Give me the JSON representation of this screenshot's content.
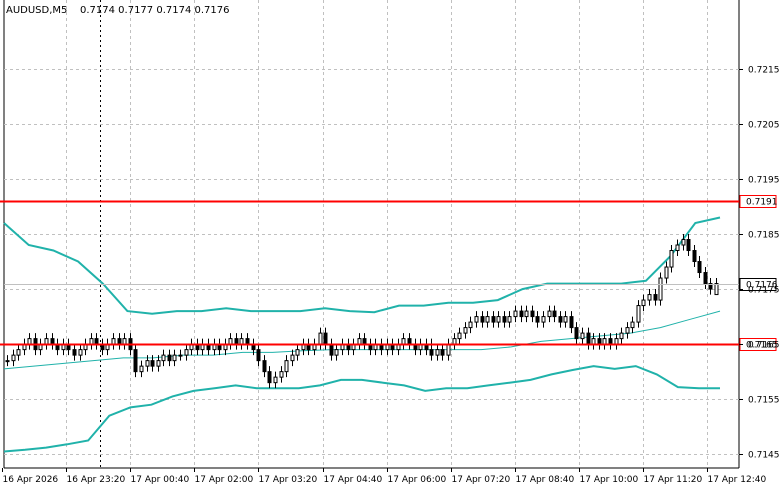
{
  "header": {
    "symbol_label": "AUDUSD,M5",
    "ohlc_label": "0.7174 0.7177 0.7174 0.7176"
  },
  "chart_data": {
    "type": "candlestick",
    "symbol": "AUDUSD",
    "timeframe": "M5",
    "ylim": [
      0.71425,
      0.72275
    ],
    "y_ticks": [
      "0.7215",
      "0.7205",
      "0.7195",
      "0.7185",
      "0.7175",
      "0.7165",
      "0.7155",
      "0.7145"
    ],
    "x_ticks": [
      "16 Apr 2026",
      "16 Apr 23:20",
      "17 Apr 00:40",
      "17 Apr 02:00",
      "17 Apr 03:20",
      "17 Apr 04:40",
      "17 Apr 06:00",
      "17 Apr 07:20",
      "17 Apr 08:40",
      "17 Apr 10:00",
      "17 Apr 11:20",
      "17 Apr 12:40"
    ],
    "grid": true,
    "horizontal_lines": [
      {
        "value": 0.7191,
        "label": "0.7191",
        "color": "#ff0000"
      },
      {
        "value": 0.7165,
        "label": "0.7165",
        "color": "#ff0000"
      }
    ],
    "current_price": {
      "value": 0.7176,
      "label": "0.7176"
    },
    "period_separator_x": "16 Apr 23:20",
    "bollinger": {
      "color": "#20b2aa",
      "upper": [
        0.7187,
        0.7183,
        0.7182,
        0.718,
        0.7176,
        0.7171,
        0.71705,
        0.7171,
        0.7171,
        0.71715,
        0.7171,
        0.7171,
        0.7171,
        0.71715,
        0.7171,
        0.71708,
        0.7172,
        0.7172,
        0.71725,
        0.71725,
        0.7173,
        0.7175,
        0.7176,
        0.7176,
        0.7176,
        0.7176,
        0.71765,
        0.7181,
        0.7187,
        0.7188
      ],
      "middle": [
        0.71605,
        0.7161,
        0.71615,
        0.7162,
        0.71625,
        0.71625,
        0.7163,
        0.7163,
        0.71635,
        0.71635,
        0.71638,
        0.7164,
        0.7164,
        0.7164,
        0.7164,
        0.7164,
        0.7164,
        0.71645,
        0.71655,
        0.7166,
        0.71665,
        0.7167,
        0.7168,
        0.71695,
        0.7171
      ],
      "lower": [
        0.71455,
        0.71458,
        0.71462,
        0.71468,
        0.71475,
        0.7152,
        0.71535,
        0.7154,
        0.71555,
        0.71565,
        0.7157,
        0.71575,
        0.7157,
        0.7157,
        0.7157,
        0.71575,
        0.71585,
        0.71585,
        0.7158,
        0.71575,
        0.71565,
        0.7157,
        0.7157,
        0.71575,
        0.7158,
        0.71585,
        0.71595,
        0.71603,
        0.7161,
        0.71605,
        0.7161,
        0.71595,
        0.71572,
        0.7157,
        0.7157
      ]
    },
    "candles": [
      [
        0.7162,
        0.7163,
        0.7161,
        0.7162
      ],
      [
        0.7162,
        0.7164,
        0.7161,
        0.7163
      ],
      [
        0.7163,
        0.7165,
        0.7162,
        0.7164
      ],
      [
        0.7164,
        0.7166,
        0.7163,
        0.7165
      ],
      [
        0.7165,
        0.7167,
        0.7164,
        0.7166
      ],
      [
        0.7166,
        0.7167,
        0.7163,
        0.7164
      ],
      [
        0.7164,
        0.7166,
        0.7163,
        0.7165
      ],
      [
        0.7165,
        0.7167,
        0.7164,
        0.7166
      ],
      [
        0.7166,
        0.7167,
        0.7164,
        0.7165
      ],
      [
        0.7165,
        0.7166,
        0.7163,
        0.7164
      ],
      [
        0.7164,
        0.7166,
        0.7163,
        0.7165
      ],
      [
        0.7165,
        0.7166,
        0.7163,
        0.7164
      ],
      [
        0.7164,
        0.7165,
        0.7162,
        0.7163
      ],
      [
        0.7163,
        0.7165,
        0.7162,
        0.7164
      ],
      [
        0.7164,
        0.7166,
        0.7163,
        0.7165
      ],
      [
        0.7165,
        0.7167,
        0.7164,
        0.7166
      ],
      [
        0.7166,
        0.7167,
        0.7164,
        0.7165
      ],
      [
        0.7165,
        0.7166,
        0.7163,
        0.7164
      ],
      [
        0.7164,
        0.7166,
        0.7163,
        0.7165
      ],
      [
        0.7165,
        0.7167,
        0.7164,
        0.7166
      ],
      [
        0.7166,
        0.7167,
        0.7164,
        0.7165
      ],
      [
        0.7165,
        0.7167,
        0.7164,
        0.7166
      ],
      [
        0.7166,
        0.7167,
        0.7163,
        0.7164
      ],
      [
        0.7164,
        0.7165,
        0.7159,
        0.716
      ],
      [
        0.716,
        0.7162,
        0.7159,
        0.7161
      ],
      [
        0.7161,
        0.7163,
        0.716,
        0.7162
      ],
      [
        0.7162,
        0.7163,
        0.716,
        0.7161
      ],
      [
        0.7161,
        0.7163,
        0.716,
        0.7162
      ],
      [
        0.7162,
        0.7164,
        0.7161,
        0.7163
      ],
      [
        0.7163,
        0.7164,
        0.7161,
        0.7162
      ],
      [
        0.7162,
        0.7164,
        0.7161,
        0.7163
      ],
      [
        0.7163,
        0.7164,
        0.7162,
        0.7163
      ],
      [
        0.7163,
        0.7165,
        0.7162,
        0.7164
      ],
      [
        0.7164,
        0.7166,
        0.7163,
        0.7165
      ],
      [
        0.7165,
        0.7166,
        0.7163,
        0.7164
      ],
      [
        0.7164,
        0.7166,
        0.7163,
        0.7165
      ],
      [
        0.7165,
        0.7166,
        0.7163,
        0.7164
      ],
      [
        0.7164,
        0.7166,
        0.7163,
        0.7165
      ],
      [
        0.7165,
        0.7166,
        0.7163,
        0.7164
      ],
      [
        0.7164,
        0.7166,
        0.7163,
        0.7165
      ],
      [
        0.7165,
        0.7167,
        0.7164,
        0.7166
      ],
      [
        0.7166,
        0.7167,
        0.7164,
        0.7165
      ],
      [
        0.7165,
        0.7167,
        0.7164,
        0.7166
      ],
      [
        0.7166,
        0.7167,
        0.7164,
        0.7165
      ],
      [
        0.7165,
        0.7166,
        0.7163,
        0.7164
      ],
      [
        0.7164,
        0.7165,
        0.7161,
        0.7162
      ],
      [
        0.7162,
        0.7163,
        0.7159,
        0.716
      ],
      [
        0.716,
        0.7161,
        0.7157,
        0.7158
      ],
      [
        0.7158,
        0.716,
        0.7157,
        0.7159
      ],
      [
        0.7159,
        0.7161,
        0.7158,
        0.716
      ],
      [
        0.716,
        0.7163,
        0.7159,
        0.7162
      ],
      [
        0.7162,
        0.7164,
        0.7161,
        0.7163
      ],
      [
        0.7163,
        0.7165,
        0.7162,
        0.7164
      ],
      [
        0.7164,
        0.7166,
        0.7163,
        0.7165
      ],
      [
        0.7165,
        0.7166,
        0.7163,
        0.7164
      ],
      [
        0.7164,
        0.7166,
        0.7163,
        0.7165
      ],
      [
        0.7165,
        0.7168,
        0.7164,
        0.7167
      ],
      [
        0.7167,
        0.7168,
        0.7164,
        0.7165
      ],
      [
        0.7165,
        0.7166,
        0.7162,
        0.7163
      ],
      [
        0.7163,
        0.7165,
        0.7162,
        0.7164
      ],
      [
        0.7164,
        0.7166,
        0.7163,
        0.7165
      ],
      [
        0.7165,
        0.7166,
        0.7163,
        0.7164
      ],
      [
        0.7164,
        0.7166,
        0.7163,
        0.7165
      ],
      [
        0.7165,
        0.7167,
        0.7164,
        0.7166
      ],
      [
        0.7166,
        0.7167,
        0.7164,
        0.7165
      ],
      [
        0.7165,
        0.7166,
        0.7163,
        0.7164
      ],
      [
        0.7164,
        0.7166,
        0.7163,
        0.7165
      ],
      [
        0.7165,
        0.7166,
        0.7163,
        0.7164
      ],
      [
        0.7164,
        0.7166,
        0.7163,
        0.7165
      ],
      [
        0.7165,
        0.7166,
        0.7163,
        0.7164
      ],
      [
        0.7164,
        0.7166,
        0.7163,
        0.7165
      ],
      [
        0.7165,
        0.7167,
        0.7164,
        0.7166
      ],
      [
        0.7166,
        0.7167,
        0.7164,
        0.7165
      ],
      [
        0.7165,
        0.7166,
        0.7163,
        0.7164
      ],
      [
        0.7164,
        0.7166,
        0.7163,
        0.7165
      ],
      [
        0.7165,
        0.7166,
        0.7163,
        0.7164
      ],
      [
        0.7164,
        0.7166,
        0.7162,
        0.7163
      ],
      [
        0.7163,
        0.7165,
        0.7162,
        0.7164
      ],
      [
        0.7164,
        0.7165,
        0.7162,
        0.7163
      ],
      [
        0.7163,
        0.7166,
        0.7162,
        0.7165
      ],
      [
        0.7165,
        0.7167,
        0.7164,
        0.7166
      ],
      [
        0.7166,
        0.7168,
        0.7165,
        0.7167
      ],
      [
        0.7167,
        0.7169,
        0.7166,
        0.7168
      ],
      [
        0.7168,
        0.717,
        0.7167,
        0.7169
      ],
      [
        0.7169,
        0.7171,
        0.7168,
        0.717
      ],
      [
        0.717,
        0.7171,
        0.7168,
        0.7169
      ],
      [
        0.7169,
        0.7171,
        0.7168,
        0.717
      ],
      [
        0.717,
        0.7171,
        0.7168,
        0.7169
      ],
      [
        0.7169,
        0.7171,
        0.7168,
        0.717
      ],
      [
        0.717,
        0.7171,
        0.7168,
        0.7169
      ],
      [
        0.7169,
        0.7171,
        0.7168,
        0.717
      ],
      [
        0.717,
        0.7172,
        0.7169,
        0.7171
      ],
      [
        0.7171,
        0.7172,
        0.7169,
        0.717
      ],
      [
        0.717,
        0.7172,
        0.7169,
        0.7171
      ],
      [
        0.7171,
        0.7172,
        0.7169,
        0.717
      ],
      [
        0.717,
        0.7171,
        0.7168,
        0.7169
      ],
      [
        0.7169,
        0.7171,
        0.7168,
        0.717
      ],
      [
        0.717,
        0.7172,
        0.7169,
        0.7171
      ],
      [
        0.7171,
        0.7172,
        0.7169,
        0.717
      ],
      [
        0.717,
        0.7171,
        0.7168,
        0.7169
      ],
      [
        0.7169,
        0.7171,
        0.7168,
        0.717
      ],
      [
        0.717,
        0.7171,
        0.7167,
        0.7168
      ],
      [
        0.7168,
        0.7169,
        0.7165,
        0.7166
      ],
      [
        0.7166,
        0.7168,
        0.7165,
        0.7167
      ],
      [
        0.7167,
        0.7168,
        0.7164,
        0.7165
      ],
      [
        0.7165,
        0.7167,
        0.7164,
        0.7166
      ],
      [
        0.7166,
        0.7167,
        0.7164,
        0.7165
      ],
      [
        0.7165,
        0.7167,
        0.7164,
        0.7166
      ],
      [
        0.7166,
        0.7167,
        0.7164,
        0.7165
      ],
      [
        0.7165,
        0.7167,
        0.7164,
        0.7166
      ],
      [
        0.7166,
        0.7168,
        0.7165,
        0.7167
      ],
      [
        0.7167,
        0.7169,
        0.7166,
        0.7168
      ],
      [
        0.7168,
        0.717,
        0.7167,
        0.7169
      ],
      [
        0.7169,
        0.7173,
        0.7168,
        0.7172
      ],
      [
        0.7172,
        0.7174,
        0.7171,
        0.7173
      ],
      [
        0.7173,
        0.7175,
        0.7172,
        0.7174
      ],
      [
        0.7174,
        0.7175,
        0.7172,
        0.7173
      ],
      [
        0.7173,
        0.7178,
        0.7172,
        0.7177
      ],
      [
        0.7177,
        0.718,
        0.7176,
        0.7179
      ],
      [
        0.7179,
        0.7183,
        0.7178,
        0.7182
      ],
      [
        0.7182,
        0.7184,
        0.7181,
        0.7183
      ],
      [
        0.7183,
        0.7185,
        0.7182,
        0.7184
      ],
      [
        0.7184,
        0.7185,
        0.7181,
        0.7182
      ],
      [
        0.7182,
        0.7183,
        0.7179,
        0.718
      ],
      [
        0.718,
        0.7181,
        0.7177,
        0.7178
      ],
      [
        0.7178,
        0.7179,
        0.7175,
        0.7176
      ],
      [
        0.7176,
        0.7177,
        0.7174,
        0.7175
      ],
      [
        0.7174,
        0.7177,
        0.7174,
        0.7176
      ]
    ]
  },
  "colors": {
    "background": "#ffffff",
    "grid": "#c0c0c0",
    "bands": "#20b2aa",
    "level_line": "#ff0000",
    "candle": "#000000"
  }
}
